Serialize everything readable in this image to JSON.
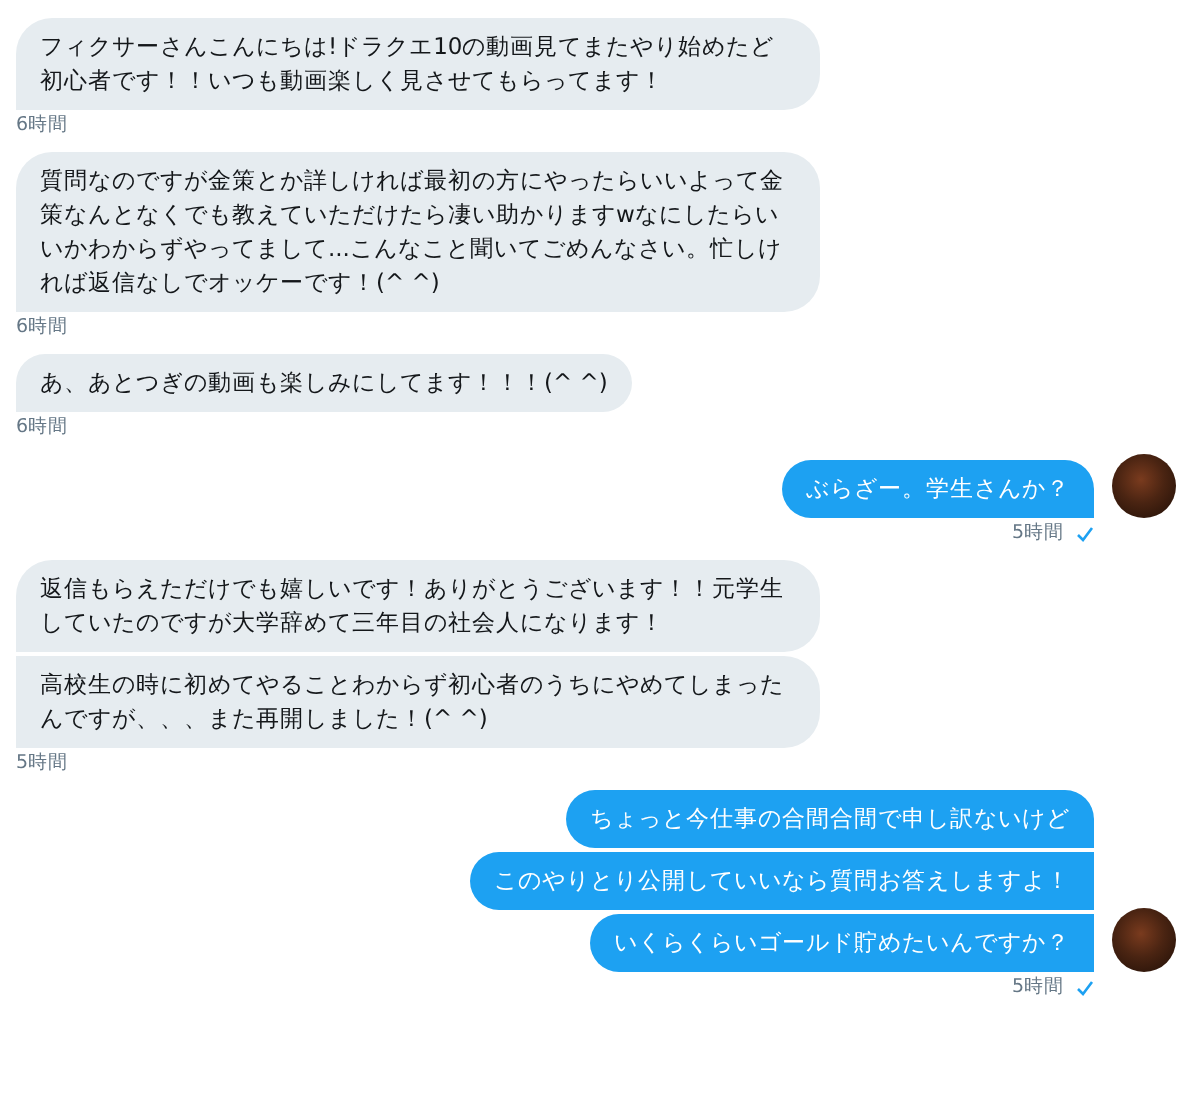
{
  "conversation": [
    {
      "kind": "received",
      "messages": [
        "フィクサーさんこんにちは!ドラクエ10の動画見てまたやり始めたど初心者です！！いつも動画楽しく見させてもらってます！"
      ],
      "time": "6時間"
    },
    {
      "kind": "received",
      "messages": [
        "質問なのですが金策とか詳しければ最初の方にやったらいいよって金策なんとなくでも教えていただけたら凄い助かりますwなにしたらいいかわからずやってまして...こんなこと聞いてごめんなさい。忙しければ返信なしでオッケーです！(^ ^)"
      ],
      "time": "6時間"
    },
    {
      "kind": "received",
      "messages": [
        "あ、あとつぎの動画も楽しみにしてます！！！(^ ^)"
      ],
      "time": "6時間"
    },
    {
      "kind": "sent",
      "messages": [
        "ぶらざー。学生さんか？"
      ],
      "time": "5時間",
      "read": true
    },
    {
      "kind": "received",
      "messages": [
        "返信もらえただけでも嬉しいです！ありがとうございます！！元学生していたのですが大学辞めて三年目の社会人になります！",
        "高校生の時に初めてやることわからず初心者のうちにやめてしまったんですが、、、また再開しました！(^ ^)"
      ],
      "time": "5時間"
    },
    {
      "kind": "sent",
      "messages": [
        "ちょっと今仕事の合間合間で申し訳ないけど",
        "このやりとり公開していいなら質問お答えしますよ！",
        "いくらくらいゴールド貯めたいんですか？"
      ],
      "time": "5時間",
      "read": true
    }
  ]
}
